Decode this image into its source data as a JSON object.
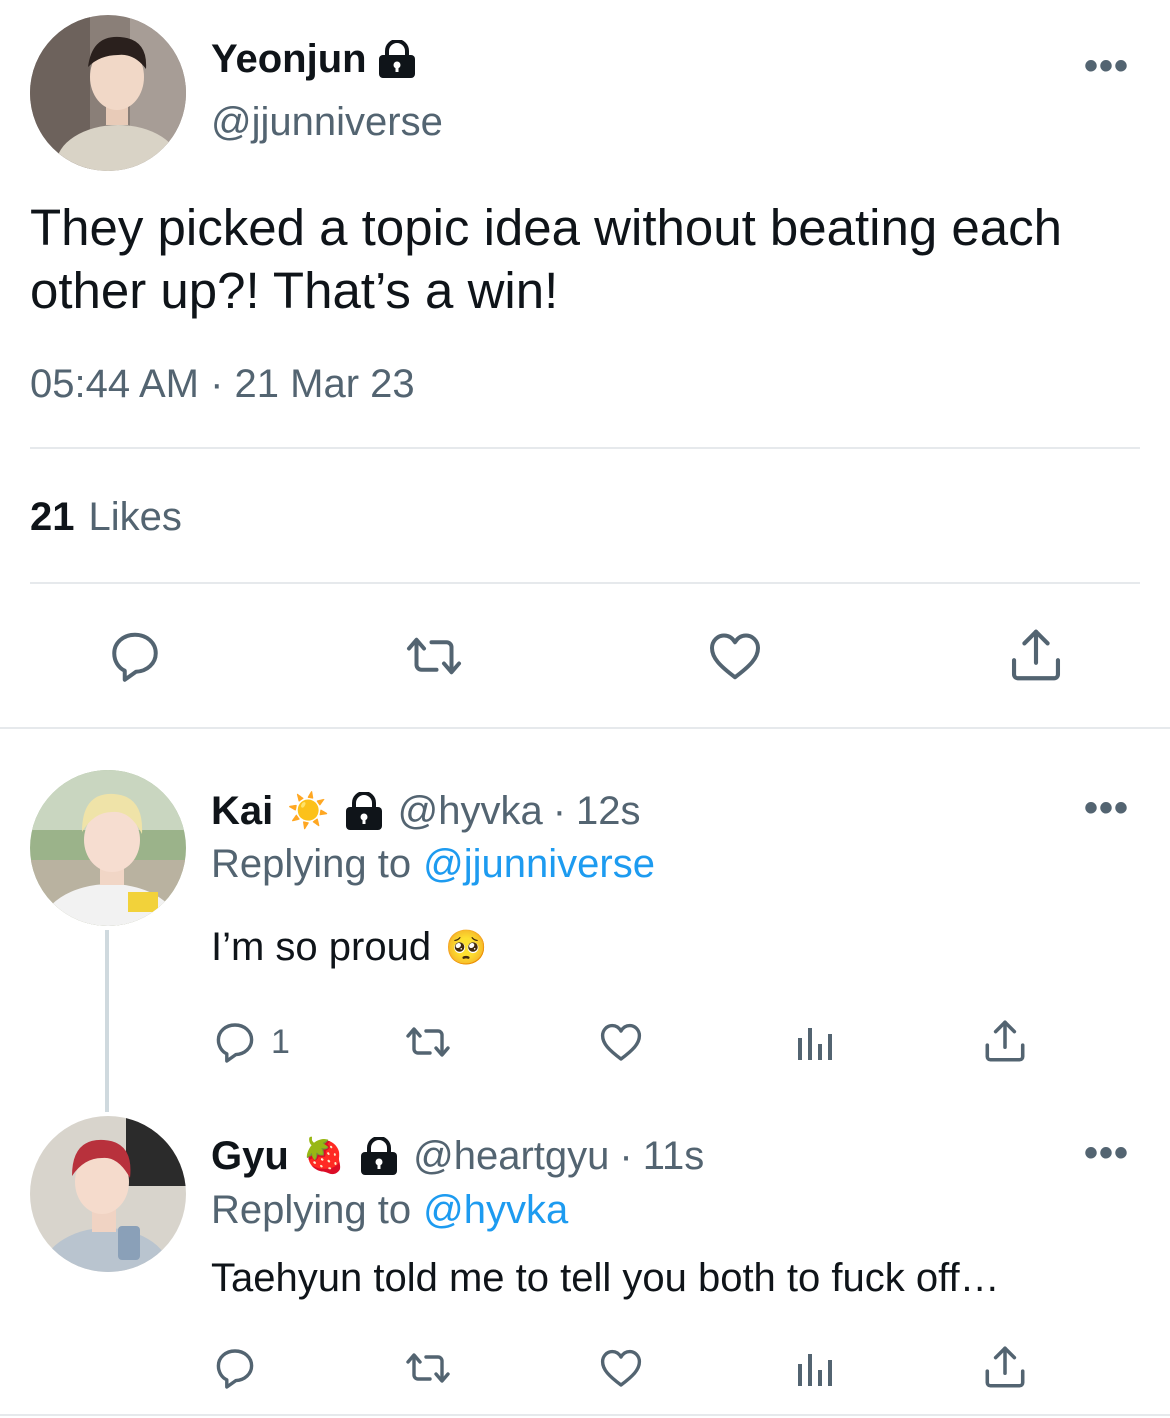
{
  "main_tweet": {
    "display_name": "Yeonjun",
    "handle": "@jjunniverse",
    "text": "They picked a topic idea without beating each other up?! That’s a win!",
    "timestamp": "05:44 AM · 21 Mar 23",
    "likes_count": "21",
    "likes_label": "Likes"
  },
  "replies": [
    {
      "display_name": "Kai",
      "emoji": "☀️",
      "handle": "@hyvka",
      "separator": "·",
      "time": "12s",
      "replying_prefix": "Replying to",
      "replying_to": "@jjunniverse",
      "text": "I’m so proud",
      "text_emoji": "🥺",
      "reply_count": "1"
    },
    {
      "display_name": "Gyu",
      "emoji": "🍓",
      "handle": "@heartgyu",
      "separator": "·",
      "time": "11s",
      "replying_prefix": "Replying to",
      "replying_to": "@hyvka",
      "text": "Taehyun told me to tell you both to fuck off…",
      "reply_count": ""
    }
  ],
  "more_label": "•••",
  "colors": {
    "text": "#0f1419",
    "secondary": "#536471",
    "link": "#1d9bf0",
    "divider": "#e6e9ec"
  }
}
